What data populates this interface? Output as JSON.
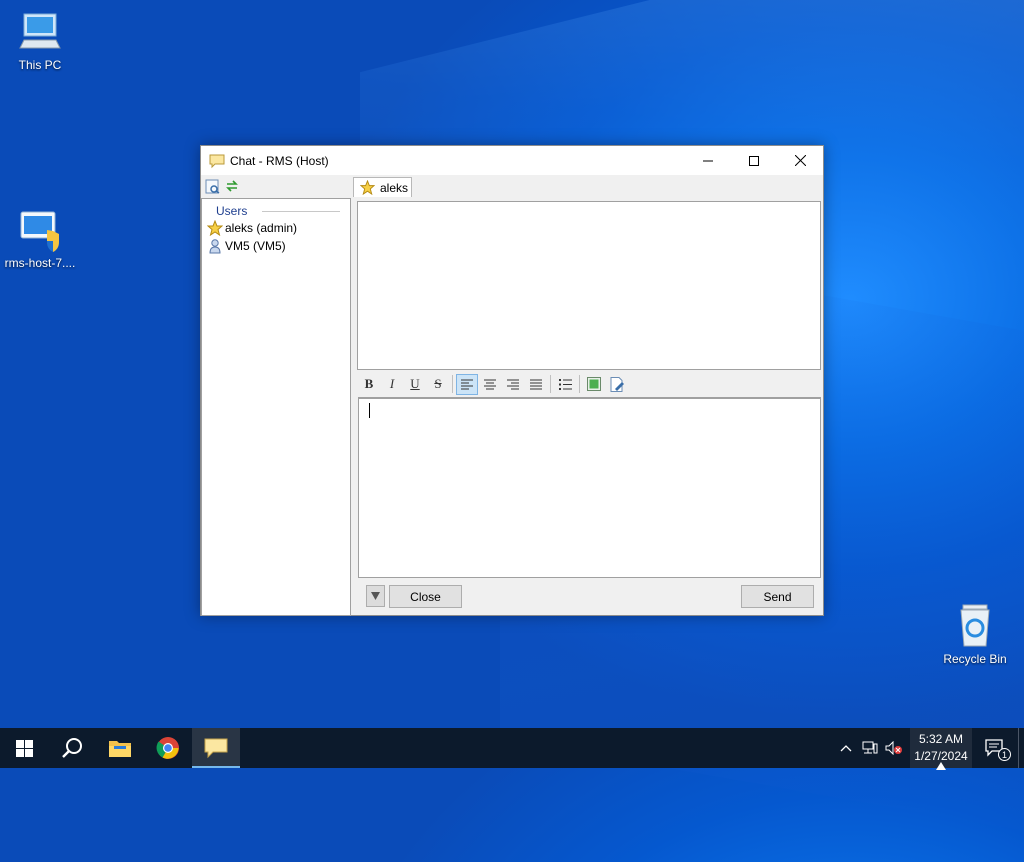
{
  "desktop": {
    "icons": [
      {
        "label": "This PC",
        "icon": "computer-icon"
      },
      {
        "label": "rms-host-7....",
        "icon": "installer-shield-icon"
      },
      {
        "label": "Recycle Bin",
        "icon": "recycle-bin-icon"
      }
    ]
  },
  "window": {
    "title": "Chat - RMS (Host)",
    "app_icon": "chat-bubble-icon",
    "controls": {
      "minimize": "minimize-icon",
      "maximize": "maximize-icon",
      "close": "close-icon"
    },
    "left_toolbar": [
      "user-properties-icon",
      "refresh-arrows-icon"
    ],
    "users_header": "Users",
    "users": [
      {
        "name": "aleks (admin)",
        "icon": "star-icon"
      },
      {
        "name": "VM5 (VM5)",
        "icon": "person-icon"
      }
    ],
    "tab": {
      "label": "aleks",
      "icon": "star-icon"
    },
    "format_toolbar": {
      "bold": "B",
      "italic": "I",
      "underline": "U",
      "strike": "S",
      "align": [
        "align-left-icon",
        "align-center-icon",
        "align-right-icon",
        "align-justify-icon"
      ],
      "active_align": "align-left-icon",
      "others": [
        "bullet-list-icon",
        "insert-image-icon",
        "insert-file-icon"
      ]
    },
    "buttons": {
      "dropdown": "dropdown-arrow-icon",
      "close": "Close",
      "send": "Send"
    }
  },
  "taskbar": {
    "items": [
      "windows-start-icon",
      "search-icon",
      "file-explorer-icon",
      "chrome-icon",
      "chat-app-icon"
    ],
    "active_item": "chat-app-icon",
    "tray": [
      "chevron-up-icon",
      "network-icon",
      "volume-muted-icon"
    ],
    "clock": {
      "time": "5:32 AM",
      "date": "1/27/2024"
    },
    "notifications": {
      "icon": "notification-icon",
      "count": "1"
    }
  }
}
